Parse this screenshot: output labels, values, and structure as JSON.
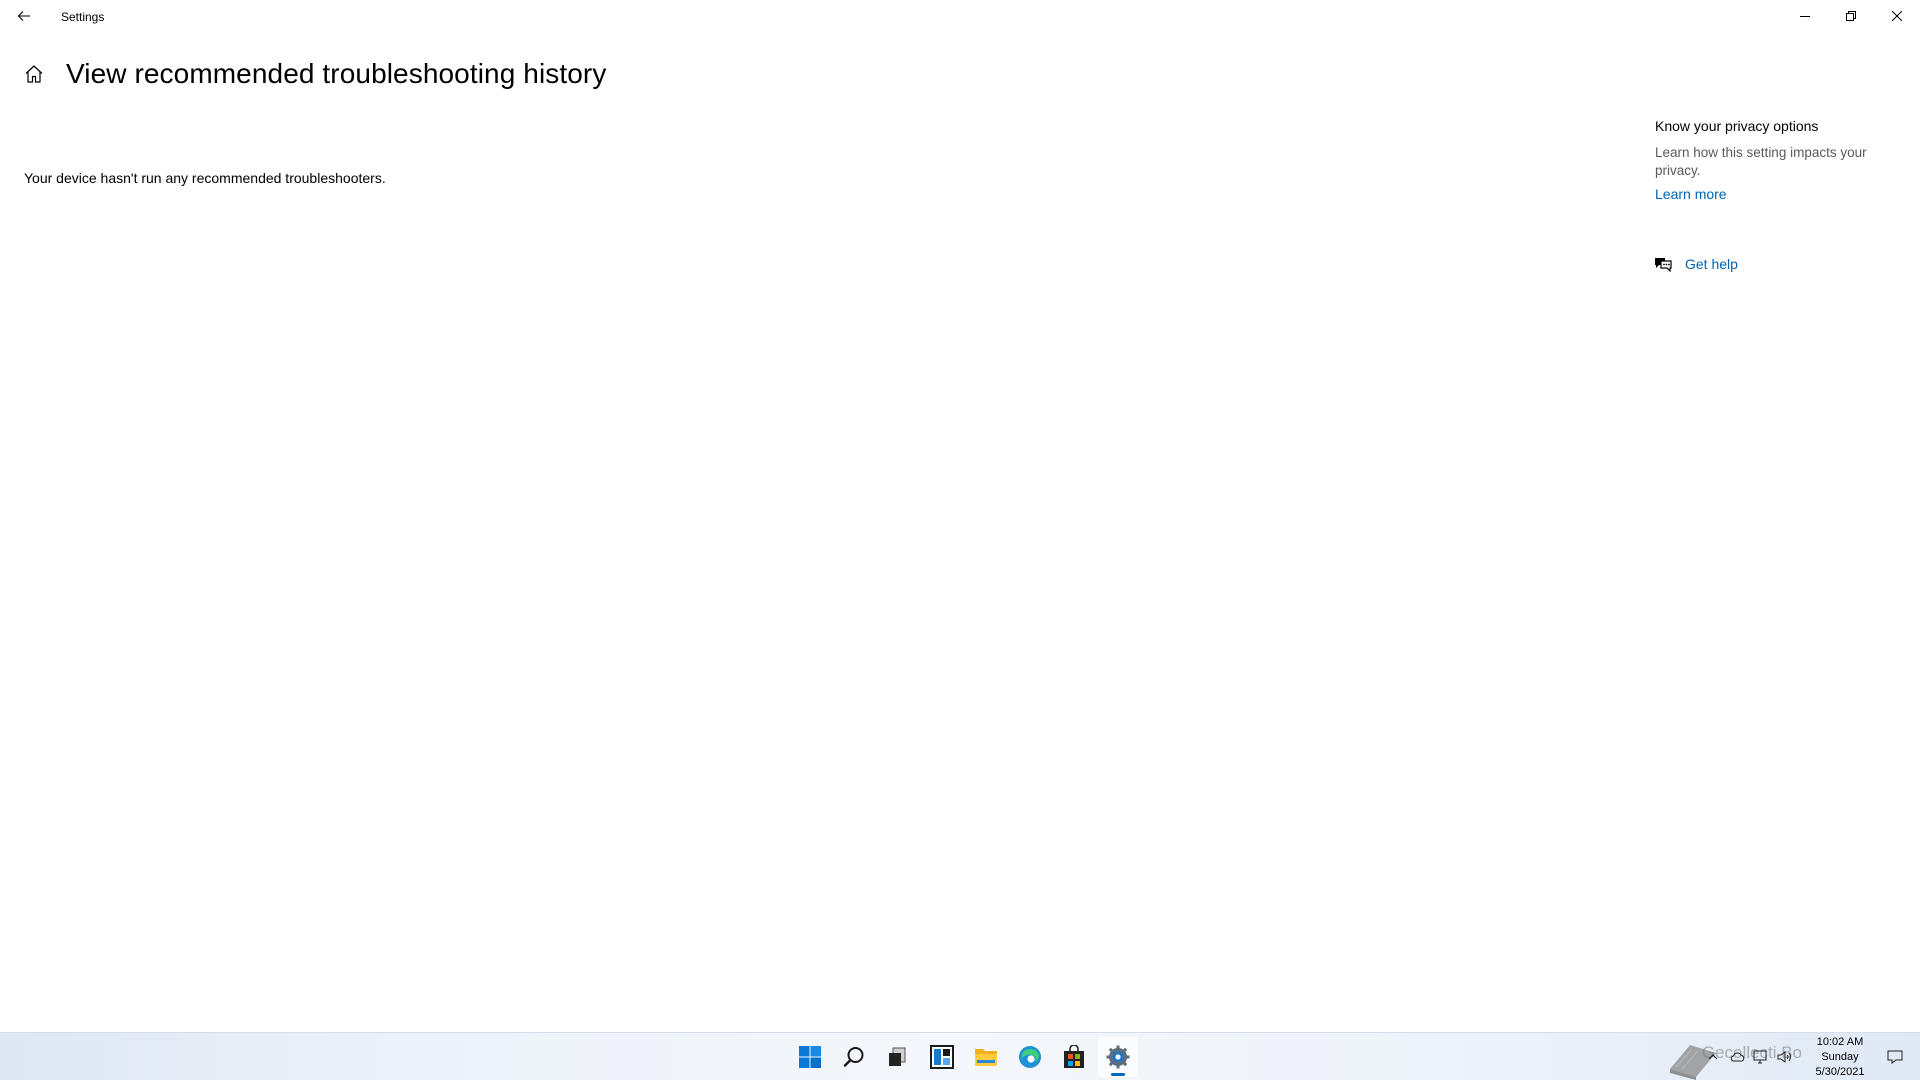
{
  "window": {
    "app_title": "Settings"
  },
  "header": {
    "title": "View recommended troubleshooting history"
  },
  "main": {
    "empty_message": "Your device hasn't run any recommended troubleshooters."
  },
  "right_panel": {
    "privacy_title": "Know your privacy options",
    "privacy_desc": "Learn how this setting impacts your privacy.",
    "learn_more": "Learn more",
    "get_help": "Get help"
  },
  "taskbar": {
    "apps": [
      "start-icon",
      "search-icon",
      "task-view-icon",
      "widgets-icon",
      "file-explorer-icon",
      "edge-icon",
      "store-icon",
      "settings-icon"
    ],
    "active_app": "settings-icon",
    "clock": {
      "time": "10:02 AM",
      "day": "Sunday",
      "date": "5/30/2021"
    },
    "watermark": "Gecollecti Bo"
  },
  "colors": {
    "link": "#0063b1",
    "accent": "#0067c0",
    "secondary_text": "#5a5a5a"
  }
}
